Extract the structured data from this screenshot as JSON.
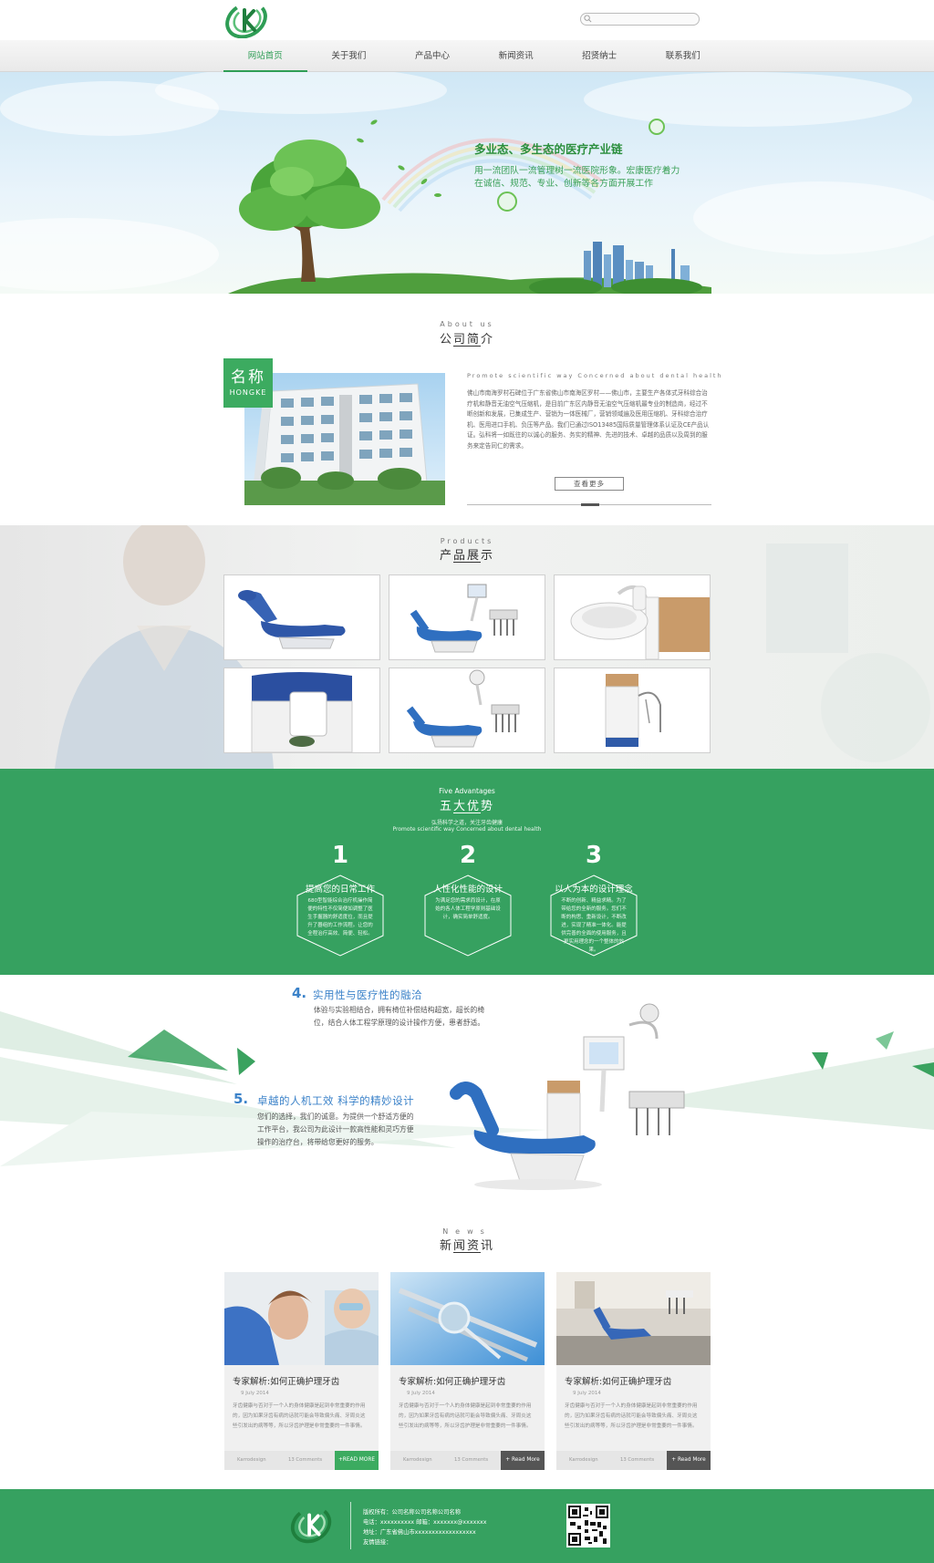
{
  "nav": {
    "items": [
      {
        "label": "网站首页",
        "active": true
      },
      {
        "label": "关于我们"
      },
      {
        "label": "产品中心"
      },
      {
        "label": "新闻资讯"
      },
      {
        "label": "招贤纳士"
      },
      {
        "label": "联系我们"
      }
    ]
  },
  "search": {
    "placeholder": ""
  },
  "banner": {
    "title": "多业态、多生态的医疗产业链",
    "line1": "用一流团队一流管理树一流医院形象。宏康医疗着力",
    "line2": "在诚信、规范、专业、创新等各方面开展工作"
  },
  "about": {
    "title_en": "About us",
    "title_cn": "公司简介",
    "badge_cn": "名称",
    "badge_en": "HONGKE",
    "tagline": "Promote scientific way Concerned about dental health",
    "body": "佛山市南海罗村石碑位于广东省佛山市南海区罗村——佛山市，主要生产各体式牙科综合治疗机和静音无油空气压缩机，是目前广东区内静音无油空气压缩机最专业的制造商，经过不断创新和发展，已集成生产、营销为一体医械厂，营销领域遍及医用压缩机、牙科综合治疗机、医用进口手机、负压等产品。我们已通过ISO13485国际质量管理体系认证及CE产品认证。弘科将一如既往的以诚心的服务、务实的精神、先进的技术、卓越的品质以及周到的服务来定告同仁的需求。",
    "more_label": "查看更多"
  },
  "products": {
    "title_en": "Products",
    "title_cn": "产品展示"
  },
  "advantages": {
    "title_en": "Five Advantages",
    "title_cn": "五大优势",
    "sub1": "弘扬科学之道，关注牙齿健康",
    "sub2": "Promote scientific way Concerned about dental health",
    "items": [
      {
        "num": "1",
        "title": "提高您的日常工作",
        "body": "680型智能综合治疗机操作简便的特性不仅简便如调整了医生手握器的舒适度位，而且提升了器组的工作流程。让您的全程治疗高效、简便、轻松。"
      },
      {
        "num": "2",
        "title": "人性化性能的设计",
        "body": "为满足您的需求而设计，在原始的各人体工程学原则基础设计，确实简单舒适度。"
      },
      {
        "num": "3",
        "title": "以人为本的设计理念",
        "body": "不断的创新、精益求精。为了带给您的全新的服务。您们不断的构思、重新设计，不断改进，实现了精准一体化。能提供完善的全面的使用服务，且更实用理念的一个整体的效果。"
      }
    ]
  },
  "features": [
    {
      "num": "4.",
      "title": "实用性与医疗性的融洽",
      "line1": "体验与实验相结合，拥有椅位补偿结构超宽，超长的椅",
      "line2": "位，结合人体工程学原理的设计操作方便，患者舒适。"
    },
    {
      "num": "5.",
      "title": "卓越的人机工效   科学的精妙设计",
      "line1": "您们的选择，我们的诚意。为提供一个舒适方便的",
      "line2": "工作平台，我公司为此设计一款高性能和灵巧方便",
      "line3": "操作的治疗台，将带给您更好的服务。"
    }
  ],
  "news": {
    "title_en": "News",
    "title_cn": "新闻资讯",
    "items": [
      {
        "title": "专家解析:如何正确护理牙齿",
        "date": "9 July 2014",
        "body": "牙齿健康与否对于一个人的身体健康是起到非常重要的作用的，因为如果牙齿有病的话就可能会导致偏头痛、牙周炎这些引发出的病等等，所以牙齿护理是非常重要的一件事情。",
        "author": "Karrodesign",
        "comments": "13 Comments",
        "btn": "+READ MORE",
        "btn_color": "#3cab60"
      },
      {
        "title": "专家解析:如何正确护理牙齿",
        "date": "9 July 2014",
        "body": "牙齿健康与否对于一个人的身体健康是起到非常重要的作用的，因为如果牙齿有病的话就可能会导致偏头痛、牙周炎这些引发出的病等等，所以牙齿护理是非常重要的一件事情。",
        "author": "Karrodesign",
        "comments": "13 Comments",
        "btn": "+ Read More",
        "btn_color": "#555555"
      },
      {
        "title": "专家解析:如何正确护理牙齿",
        "date": "9 July 2014",
        "body": "牙齿健康与否对于一个人的身体健康是起到非常重要的作用的，因为如果牙齿有病的话就可能会导致偏头痛、牙周炎这些引发出的病等等，所以牙齿护理是非常重要的一件事情。",
        "author": "Karrodesign",
        "comments": "13 Comments",
        "btn": "+ Read More",
        "btn_color": "#555555"
      }
    ]
  },
  "footer": {
    "copyright": "版权所有：公司名称公司名称公司名称",
    "contact": "电话：xxxxxxxxxx    邮箱：xxxxxxx@xxxxxxx",
    "address": "地址：广东省佛山市xxxxxxxxxxxxxxxxxx",
    "links": "友情链接："
  },
  "colors": {
    "brand_green": "#36a160",
    "accent_blue": "#3b82c9"
  }
}
